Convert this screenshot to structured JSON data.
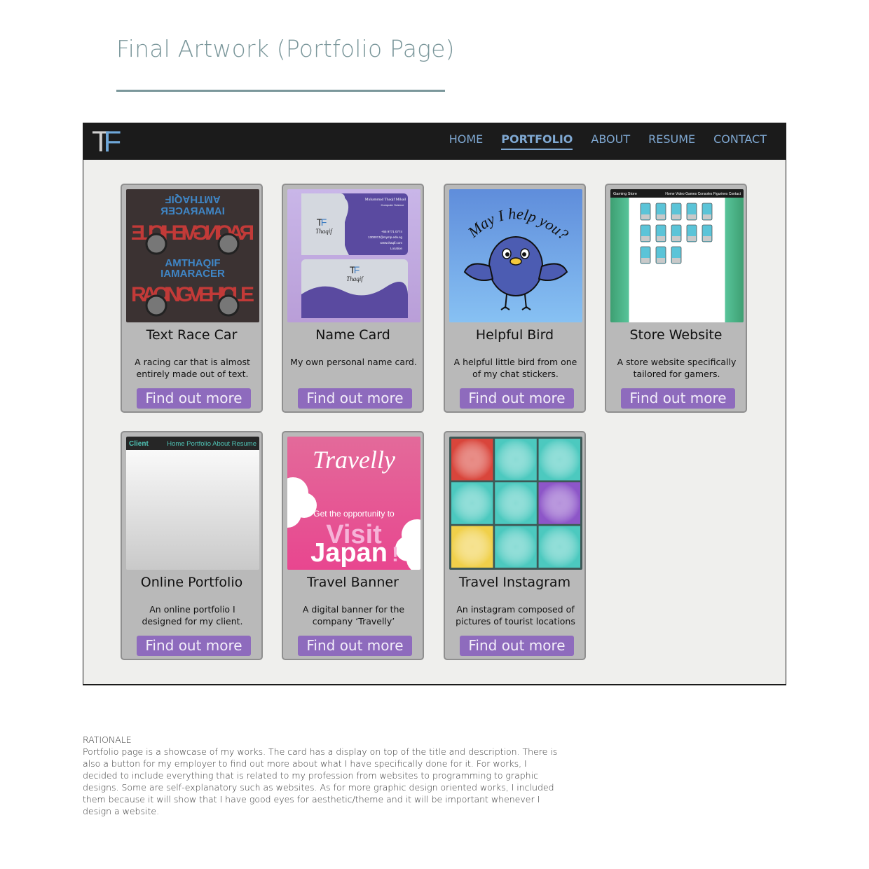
{
  "heading": "Final Artwork (Portfolio Page)",
  "colors": {
    "heading": "#7b979b",
    "navbar": "#1b1b1b",
    "nav_link": "#7fa8d2",
    "card_bg": "#b9b9b9",
    "button": "#8e6bbd",
    "page_bg": "#efefed"
  },
  "mockup": {
    "logo": {
      "t": "T",
      "f": "F"
    },
    "nav": [
      {
        "label": "HOME",
        "active": false
      },
      {
        "label": "PORTFOLIO",
        "active": true
      },
      {
        "label": "ABOUT",
        "active": false
      },
      {
        "label": "RESUME",
        "active": false
      },
      {
        "label": "CONTACT",
        "active": false
      }
    ],
    "cards": [
      {
        "title": "Text Race Car",
        "desc": "A racing car that is almost entirely made out of text.",
        "button": "Find out more",
        "art": {
          "top1": "AMTHAQIF",
          "top2": "IAMARACER",
          "big": "RACINGVEHICLE"
        }
      },
      {
        "title": "Name Card",
        "desc": "My own personal name card.",
        "button": "Find out more",
        "art": {
          "name": "Muhammad Thaqif Mikail",
          "role": "Computer Science",
          "logo_text": "Thaqif",
          "phone": "+65 9771 0774",
          "email": "130007J@mymp.edu.sg",
          "web": "www.thaqif.com",
          "location": "Location"
        }
      },
      {
        "title": "Helpful Bird",
        "desc": "A helpful little bird from one of my chat stickers.",
        "button": "Find out more",
        "art": {
          "caption": "May I help you?"
        }
      },
      {
        "title": "Store Website",
        "desc": "A store website specifically tailored for gamers.",
        "button": "Find out more",
        "art": {
          "brand": "Gaming Store",
          "menu": "Home  Video Games  Consoles  Figurines  Contact"
        }
      },
      {
        "title": "Online Portfolio",
        "desc": "An online portfolio I designed for my client.",
        "button": "Find out more",
        "art": {
          "brand": "Client",
          "menu": "Home Portfolio About Resume"
        }
      },
      {
        "title": "Travel Banner",
        "desc": "A digital banner for the company ‘Travelly’",
        "button": "Find out more",
        "art": {
          "brand": "Travelly",
          "line1": "Get the opportunity to",
          "line2": "Visit",
          "line3": "Japan",
          "bang": "!"
        }
      },
      {
        "title": "Travel Instagram",
        "desc": "An instagram composed of pictures of tourist locations",
        "button": "Find out more",
        "art": {
          "tiles": [
            "#d9453b",
            "#4cc9bf",
            "#4cc9bf",
            "#4cc9bf",
            "#4cc9bf",
            "#8d56c8",
            "#f0d04a",
            "#4cc9bf",
            "#4cc9bf"
          ]
        }
      }
    ]
  },
  "rationale": {
    "title": "RATIONALE",
    "body": "Portfolio page is a showcase of my works. The card has a display on top of the title and description. There is also a button for my employer to find out more about what I have specifically done for it. For works, I decided to include everything that is related to my profession from websites to programming to graphic designs. Some are self-explanatory such as websites. As for more graphic design oriented works, I included them because it will show that I have good eyes for aesthetic/theme and it will be important whenever I design a website."
  }
}
